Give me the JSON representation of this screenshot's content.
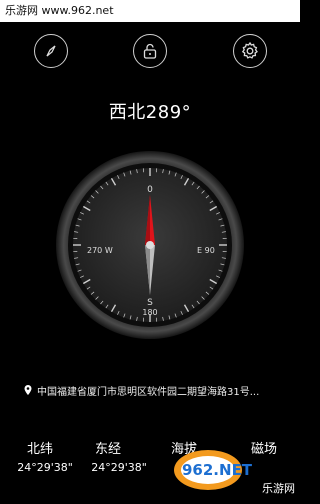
{
  "watermark": {
    "site": "乐游网 www.962.net"
  },
  "toolbar": {
    "compass_icon": "compass-icon",
    "lock_icon": "unlock-icon",
    "settings_icon": "gear-icon"
  },
  "heading": "西北289°",
  "compass": {
    "north_label": "0",
    "south_label": "S",
    "south_deg": "180",
    "west_label": "270 W",
    "east_label": "E 90",
    "needle_color": "#e0141b",
    "bezel_color": "#2a2a2a"
  },
  "location": {
    "address": "中国福建省厦门市思明区软件园二期望海路31号..."
  },
  "stats": [
    {
      "label": "北纬",
      "value": "24°29'38\""
    },
    {
      "label": "东经",
      "value": "24°29'38\""
    },
    {
      "label": "海拔",
      "value": ""
    },
    {
      "label": "磁场",
      "value": ""
    }
  ],
  "brand": {
    "logo_text": "962.NET",
    "logo_sub": "乐游网"
  }
}
